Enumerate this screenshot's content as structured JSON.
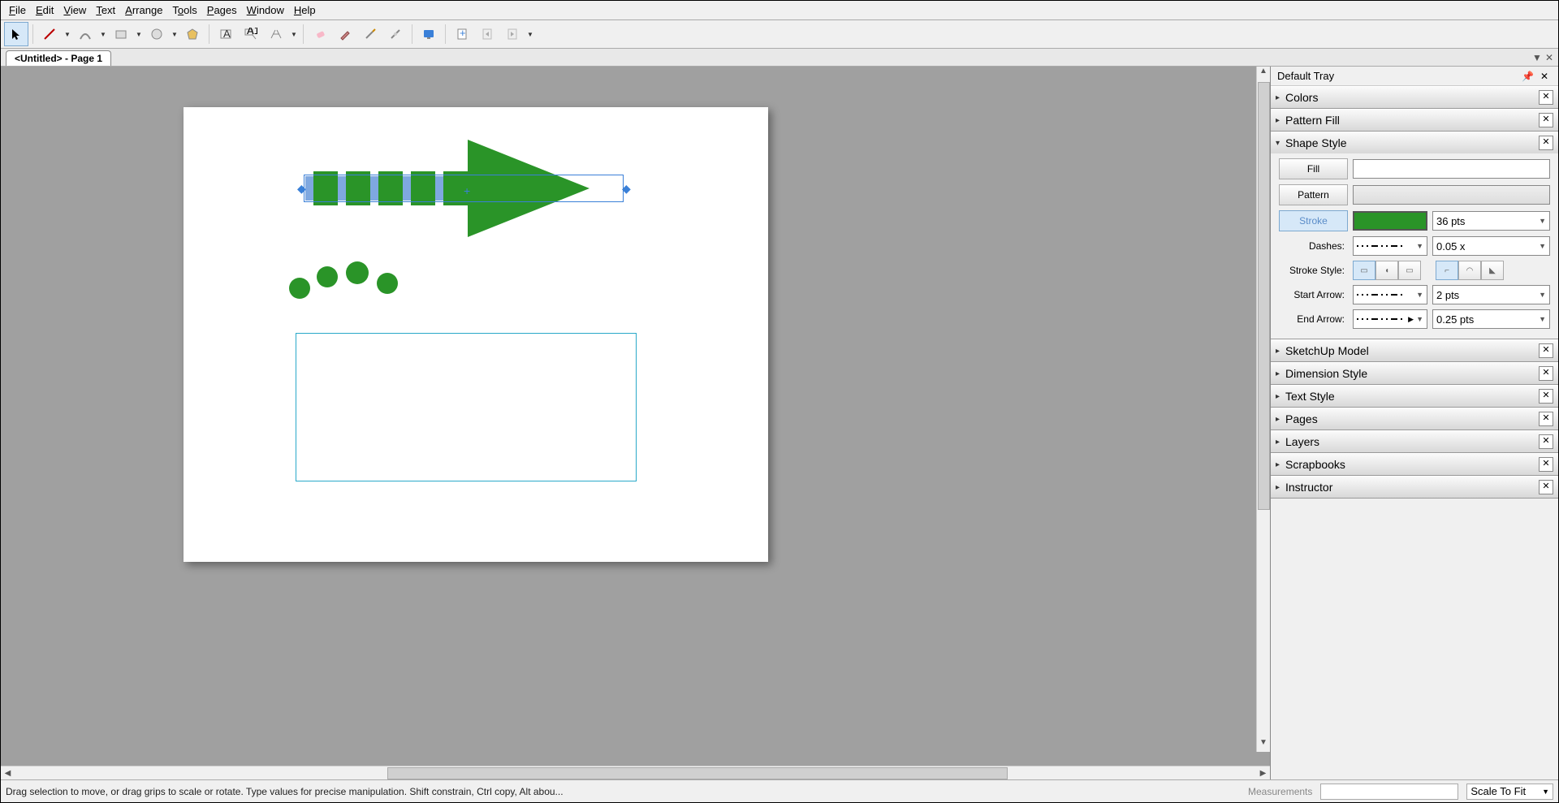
{
  "menu": {
    "file": "File",
    "edit": "Edit",
    "view": "View",
    "text": "Text",
    "arrange": "Arrange",
    "tools": "Tools",
    "pages": "Pages",
    "window": "Window",
    "help": "Help"
  },
  "tab": {
    "title": "<Untitled> - Page 1"
  },
  "tray": {
    "title": "Default Tray",
    "panels": {
      "colors": "Colors",
      "pattern_fill": "Pattern Fill",
      "shape_style": "Shape Style",
      "sketchup": "SketchUp Model",
      "dimension": "Dimension Style",
      "text_style": "Text Style",
      "pages": "Pages",
      "layers": "Layers",
      "scrapbooks": "Scrapbooks",
      "instructor": "Instructor"
    },
    "shape_style": {
      "fill_label": "Fill",
      "pattern_label": "Pattern",
      "stroke_label": "Stroke",
      "stroke_size": "36 pts",
      "dashes_label": "Dashes:",
      "dashes_scale": "0.05 x",
      "stroke_style_label": "Stroke Style:",
      "start_arrow_label": "Start Arrow:",
      "start_arrow_size": "2 pts",
      "end_arrow_label": "End Arrow:",
      "end_arrow_size": "0.25 pts"
    }
  },
  "status": {
    "hint": "Drag selection to move, or drag grips to scale or rotate. Type values for precise manipulation. Shift constrain, Ctrl copy, Alt abou...",
    "measurements_label": "Measurements",
    "zoom": "Scale To Fit"
  },
  "colors": {
    "green": "#2a9428",
    "selection": "#7fa8e0"
  }
}
